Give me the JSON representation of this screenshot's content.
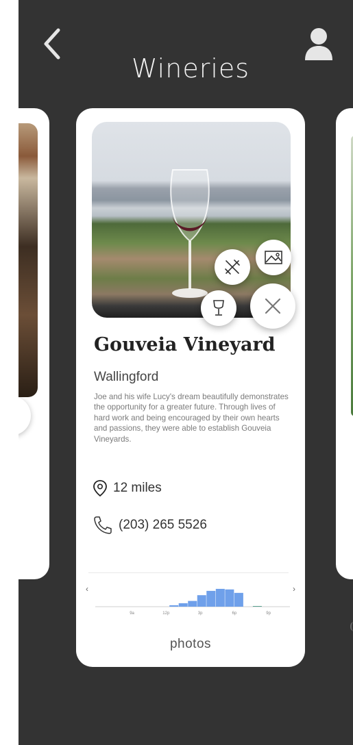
{
  "header": {
    "title": "Wineries",
    "back_icon": "chevron-left-icon",
    "profile_icon": "user-icon"
  },
  "card": {
    "name": "Gouveia Vineyard",
    "town": "Wallingford",
    "description": "Joe and his wife Lucy's dream beautifully demonstrates the opportunity for a greater future. Through lives of hard work and being encouraged by their own hearts and passions, they were able to establish Gouveia Vineyards.",
    "distance": "12 miles",
    "phone": "(203) 265 5526",
    "photos_label": "photos",
    "actions": [
      "dining-icon",
      "gallery-icon",
      "wine-glass-icon",
      "close-icon"
    ]
  },
  "colors": {
    "background": "#333333",
    "card": "#ffffff",
    "chart_bar": "#6fa0ea",
    "chart_highlight": "#3a8f7a"
  },
  "chart_data": {
    "type": "bar",
    "title": "",
    "x_tick_labels": [
      "9a",
      "12p",
      "3p",
      "6p",
      "9p"
    ],
    "values": [
      0,
      0,
      0,
      0,
      0,
      0,
      0,
      0,
      0.05,
      0.12,
      0.2,
      0.4,
      0.55,
      0.62,
      0.6,
      0.48,
      0,
      0.02,
      0,
      0,
      0
    ],
    "ylim": [
      0,
      1
    ],
    "grid": false,
    "nav_prev": "‹",
    "nav_next": "›"
  }
}
